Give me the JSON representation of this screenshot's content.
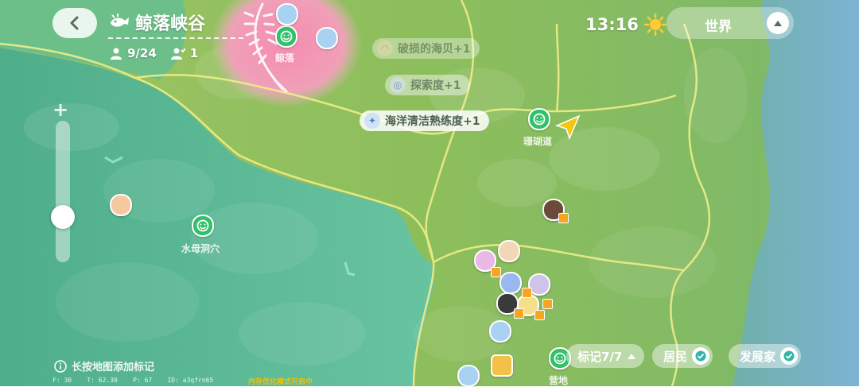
{
  "header": {
    "title": "鲸落峡谷",
    "players": "9/24",
    "friends": "1"
  },
  "clock": {
    "time": "13:16"
  },
  "world_selector": {
    "label": "世界"
  },
  "notifications": [
    {
      "text": "破损的海贝+1"
    },
    {
      "text": "探索度+1"
    },
    {
      "text": "海洋清洁熟练度+1"
    }
  ],
  "map_labels": {
    "whale_fall": "鲸落",
    "coral_road": "珊瑚道",
    "jellyfish_cave": "水母洞穴",
    "camp": "营地"
  },
  "hint": {
    "text": "长按地图添加标记"
  },
  "debug": {
    "text": "F: 30    T: 62.30    P: 67    ID: a3qfrn65"
  },
  "perf_notice": {
    "text": "内存优化模式开启中"
  },
  "bottom_bar": {
    "marks_label": "标记7/7",
    "residents_label": "居民",
    "developers_label": "发展家"
  },
  "colors": {
    "sea_green": "#5fbf9a",
    "land_green": "#8fbf5c",
    "ocean_blue": "#7fb6cf",
    "whale_pink": "#f08aa8",
    "marker_green": "#33c06a",
    "check_teal": "#2fb5a8",
    "arrow_yellow": "#f2c80f"
  }
}
